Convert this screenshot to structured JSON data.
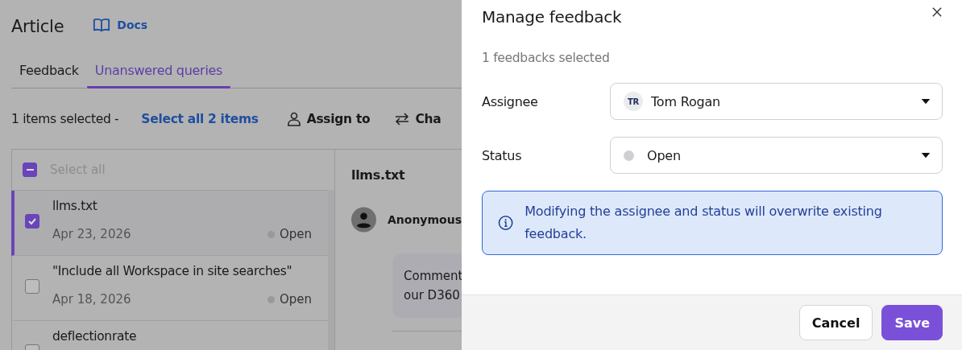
{
  "page": {
    "title": "Article",
    "docs_link": "Docs",
    "tabs": [
      {
        "label": "Feedback",
        "selected": false
      },
      {
        "label": "Unanswered queries",
        "selected": true
      }
    ],
    "toolbar": {
      "selection_text": "1 items selected -",
      "select_all_link": "Select all 2 items",
      "actions": [
        {
          "kind": "assign",
          "label": "Assign to"
        },
        {
          "kind": "change",
          "label": "Cha"
        }
      ]
    },
    "list": {
      "select_all": {
        "label": "Select all",
        "indeterminate": true
      },
      "items": [
        {
          "title": "llms.txt",
          "date": "Apr 23, 2026",
          "status": "Open",
          "checked": true,
          "selected": true
        },
        {
          "title": "\"Include all Workspace in site searches\"",
          "date": "Apr 18, 2026",
          "status": "Open",
          "checked": false,
          "selected": false
        },
        {
          "title": "deflectionrate",
          "checked": false,
          "selected": false
        }
      ]
    },
    "detail": {
      "title": "llms.txt",
      "author": "Anonymous",
      "comment_lines": [
        "Comment",
        "our D360"
      ]
    }
  },
  "dialog": {
    "title": "Manage feedback",
    "subtitle": "1 feedbacks selected",
    "fields": [
      {
        "label": "Assignee",
        "kind": "user",
        "initials": "TR",
        "value": "Tom Rogan"
      },
      {
        "label": "Status",
        "kind": "status",
        "value": "Open"
      }
    ],
    "notice": "Modifying the assignee and status will overwrite existing feedback.",
    "buttons": [
      {
        "label": "Cancel",
        "kind": "secondary"
      },
      {
        "label": "Save",
        "kind": "primary"
      }
    ]
  }
}
